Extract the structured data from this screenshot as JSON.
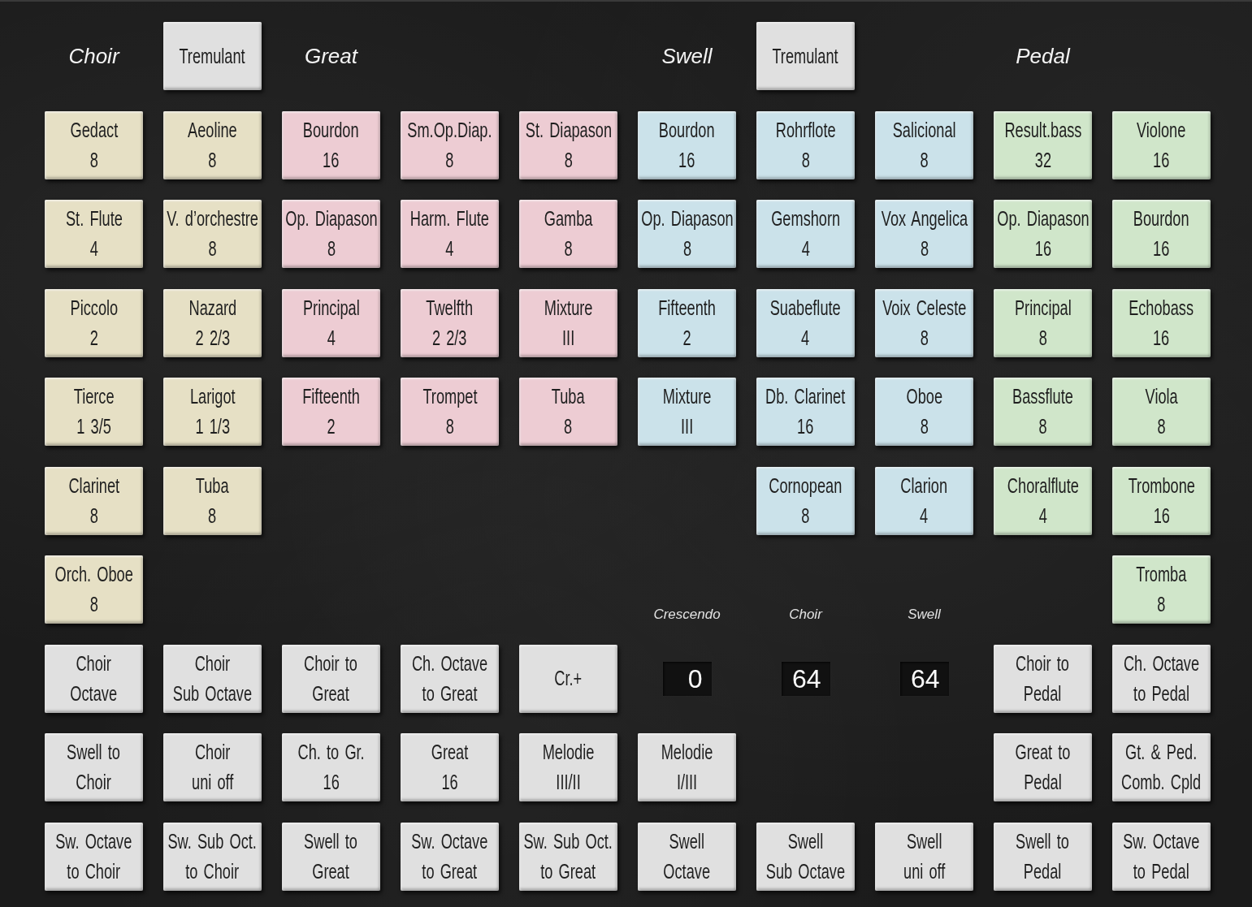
{
  "rows": [
    {
      "cells": [
        {
          "kind": "heading",
          "text": "Choir"
        },
        {
          "kind": "button",
          "lines": [
            "Tremulant"
          ],
          "color": "#e0e0e0"
        },
        {
          "kind": "heading",
          "text": "Great"
        },
        {
          "kind": "empty"
        },
        {
          "kind": "empty"
        },
        {
          "kind": "heading",
          "text": "Swell"
        },
        {
          "kind": "button",
          "lines": [
            "Tremulant"
          ],
          "color": "#e0e0e0"
        },
        {
          "kind": "empty"
        },
        {
          "kind": "heading",
          "text": "Pedal"
        },
        {
          "kind": "empty"
        }
      ]
    },
    {
      "cells": [
        {
          "kind": "button",
          "lines": [
            "Gedact",
            "8"
          ],
          "color": "#e6e0c5"
        },
        {
          "kind": "button",
          "lines": [
            "Aeoline",
            "8"
          ],
          "color": "#e6e0c5"
        },
        {
          "kind": "button",
          "lines": [
            "Bourdon",
            "16"
          ],
          "color": "#edccd3"
        },
        {
          "kind": "button",
          "lines": [
            "Sm.Op.Diap.",
            "8"
          ],
          "color": "#edccd3"
        },
        {
          "kind": "button",
          "lines": [
            "St. Diapason",
            "8"
          ],
          "color": "#edccd3"
        },
        {
          "kind": "button",
          "lines": [
            "Bourdon",
            "16"
          ],
          "color": "#cbe2ea"
        },
        {
          "kind": "button",
          "lines": [
            "Rohrflote",
            "8"
          ],
          "color": "#cbe2ea"
        },
        {
          "kind": "button",
          "lines": [
            "Salicional",
            "8"
          ],
          "color": "#cbe2ea"
        },
        {
          "kind": "button",
          "lines": [
            "Result.bass",
            "32"
          ],
          "color": "#d0e6ca"
        },
        {
          "kind": "button",
          "lines": [
            "Violone",
            "16"
          ],
          "color": "#d0e6ca"
        }
      ]
    },
    {
      "cells": [
        {
          "kind": "button",
          "lines": [
            "St. Flute",
            "4"
          ],
          "color": "#e6e0c5"
        },
        {
          "kind": "button",
          "lines": [
            "V. d’orchestre",
            "8"
          ],
          "color": "#e6e0c5"
        },
        {
          "kind": "button",
          "lines": [
            "Op. Diapason",
            "8"
          ],
          "color": "#edccd3"
        },
        {
          "kind": "button",
          "lines": [
            "Harm. Flute",
            "4"
          ],
          "color": "#edccd3"
        },
        {
          "kind": "button",
          "lines": [
            "Gamba",
            "8"
          ],
          "color": "#edccd3"
        },
        {
          "kind": "button",
          "lines": [
            "Op. Diapason",
            "8"
          ],
          "color": "#cbe2ea"
        },
        {
          "kind": "button",
          "lines": [
            "Gemshorn",
            "4"
          ],
          "color": "#cbe2ea"
        },
        {
          "kind": "button",
          "lines": [
            "Vox Angelica",
            "8"
          ],
          "color": "#cbe2ea"
        },
        {
          "kind": "button",
          "lines": [
            "Op. Diapason",
            "16"
          ],
          "color": "#d0e6ca"
        },
        {
          "kind": "button",
          "lines": [
            "Bourdon",
            "16"
          ],
          "color": "#d0e6ca"
        }
      ]
    },
    {
      "cells": [
        {
          "kind": "button",
          "lines": [
            "Piccolo",
            "2"
          ],
          "color": "#e6e0c5"
        },
        {
          "kind": "button",
          "lines": [
            "Nazard",
            "2 2/3"
          ],
          "color": "#e6e0c5"
        },
        {
          "kind": "button",
          "lines": [
            "Principal",
            "4"
          ],
          "color": "#edccd3"
        },
        {
          "kind": "button",
          "lines": [
            "Twelfth",
            "2 2/3"
          ],
          "color": "#edccd3"
        },
        {
          "kind": "button",
          "lines": [
            "Mixture",
            "III"
          ],
          "color": "#edccd3"
        },
        {
          "kind": "button",
          "lines": [
            "Fifteenth",
            "2"
          ],
          "color": "#cbe2ea"
        },
        {
          "kind": "button",
          "lines": [
            "Suabeflute",
            "4"
          ],
          "color": "#cbe2ea"
        },
        {
          "kind": "button",
          "lines": [
            "Voix Celeste",
            "8"
          ],
          "color": "#cbe2ea"
        },
        {
          "kind": "button",
          "lines": [
            "Principal",
            "8"
          ],
          "color": "#d0e6ca"
        },
        {
          "kind": "button",
          "lines": [
            "Echobass",
            "16"
          ],
          "color": "#d0e6ca"
        }
      ]
    },
    {
      "cells": [
        {
          "kind": "button",
          "lines": [
            "Tierce",
            "1 3/5"
          ],
          "color": "#e6e0c5"
        },
        {
          "kind": "button",
          "lines": [
            "Larigot",
            "1 1/3"
          ],
          "color": "#e6e0c5"
        },
        {
          "kind": "button",
          "lines": [
            "Fifteenth",
            "2"
          ],
          "color": "#edccd3"
        },
        {
          "kind": "button",
          "lines": [
            "Trompet",
            "8"
          ],
          "color": "#edccd3"
        },
        {
          "kind": "button",
          "lines": [
            "Tuba",
            "8"
          ],
          "color": "#edccd3"
        },
        {
          "kind": "button",
          "lines": [
            "Mixture",
            "III"
          ],
          "color": "#cbe2ea"
        },
        {
          "kind": "button",
          "lines": [
            "Db. Clarinet",
            "16"
          ],
          "color": "#cbe2ea"
        },
        {
          "kind": "button",
          "lines": [
            "Oboe",
            "8"
          ],
          "color": "#cbe2ea"
        },
        {
          "kind": "button",
          "lines": [
            "Bassflute",
            "8"
          ],
          "color": "#d0e6ca"
        },
        {
          "kind": "button",
          "lines": [
            "Viola",
            "8"
          ],
          "color": "#d0e6ca"
        }
      ]
    },
    {
      "cells": [
        {
          "kind": "button",
          "lines": [
            "Clarinet",
            "8"
          ],
          "color": "#e6e0c5"
        },
        {
          "kind": "button",
          "lines": [
            "Tuba",
            "8"
          ],
          "color": "#e6e0c5"
        },
        {
          "kind": "empty"
        },
        {
          "kind": "empty"
        },
        {
          "kind": "empty"
        },
        {
          "kind": "empty"
        },
        {
          "kind": "button",
          "lines": [
            "Cornopean",
            "8"
          ],
          "color": "#cbe2ea"
        },
        {
          "kind": "button",
          "lines": [
            "Clarion",
            "4"
          ],
          "color": "#cbe2ea"
        },
        {
          "kind": "button",
          "lines": [
            "Choralflute",
            "4"
          ],
          "color": "#d0e6ca"
        },
        {
          "kind": "button",
          "lines": [
            "Trombone",
            "16"
          ],
          "color": "#d0e6ca"
        }
      ]
    },
    {
      "cells": [
        {
          "kind": "button",
          "lines": [
            "Orch. Oboe",
            "8"
          ],
          "color": "#e6e0c5"
        },
        {
          "kind": "empty"
        },
        {
          "kind": "empty"
        },
        {
          "kind": "empty"
        },
        {
          "kind": "empty"
        },
        {
          "kind": "caption",
          "text": "Crescendo"
        },
        {
          "kind": "caption",
          "text": "Choir"
        },
        {
          "kind": "caption",
          "text": "Swell"
        },
        {
          "kind": "empty"
        },
        {
          "kind": "button",
          "lines": [
            "Tromba",
            "8"
          ],
          "color": "#d0e6ca"
        }
      ]
    },
    {
      "cells": [
        {
          "kind": "button",
          "lines": [
            "Choir",
            "Octave"
          ],
          "color": "#e0e0e0"
        },
        {
          "kind": "button",
          "lines": [
            "Choir",
            "Sub Octave"
          ],
          "color": "#e0e0e0"
        },
        {
          "kind": "button",
          "lines": [
            "Choir to",
            "Great"
          ],
          "color": "#e0e0e0"
        },
        {
          "kind": "button",
          "lines": [
            "Ch. Octave",
            "to Great"
          ],
          "color": "#e0e0e0"
        },
        {
          "kind": "button",
          "lines": [
            "Cr.+"
          ],
          "color": "#e0e0e0"
        },
        {
          "kind": "display",
          "value": "0"
        },
        {
          "kind": "display",
          "value": "64"
        },
        {
          "kind": "display",
          "value": "64"
        },
        {
          "kind": "button",
          "lines": [
            "Choir to",
            "Pedal"
          ],
          "color": "#e0e0e0"
        },
        {
          "kind": "button",
          "lines": [
            "Ch. Octave",
            "to Pedal"
          ],
          "color": "#e0e0e0"
        }
      ]
    },
    {
      "cells": [
        {
          "kind": "button",
          "lines": [
            "Swell to",
            "Choir"
          ],
          "color": "#e0e0e0"
        },
        {
          "kind": "button",
          "lines": [
            "Choir",
            "uni off"
          ],
          "color": "#e0e0e0"
        },
        {
          "kind": "button",
          "lines": [
            "Ch. to Gr.",
            "16"
          ],
          "color": "#e0e0e0"
        },
        {
          "kind": "button",
          "lines": [
            "Great",
            "16"
          ],
          "color": "#e0e0e0"
        },
        {
          "kind": "button",
          "lines": [
            "Melodie",
            "III/II"
          ],
          "color": "#e0e0e0"
        },
        {
          "kind": "button",
          "lines": [
            "Melodie",
            "I/III"
          ],
          "color": "#e0e0e0"
        },
        {
          "kind": "empty"
        },
        {
          "kind": "empty"
        },
        {
          "kind": "button",
          "lines": [
            "Great to",
            "Pedal"
          ],
          "color": "#e0e0e0"
        },
        {
          "kind": "button",
          "lines": [
            "Gt. & Ped.",
            "Comb. Cpld"
          ],
          "color": "#e0e0e0"
        }
      ]
    },
    {
      "cells": [
        {
          "kind": "button",
          "lines": [
            "Sw. Octave",
            "to Choir"
          ],
          "color": "#e0e0e0"
        },
        {
          "kind": "button",
          "lines": [
            "Sw. Sub Oct.",
            "to Choir"
          ],
          "color": "#e0e0e0"
        },
        {
          "kind": "button",
          "lines": [
            "Swell to",
            "Great"
          ],
          "color": "#e0e0e0"
        },
        {
          "kind": "button",
          "lines": [
            "Sw. Octave",
            "to Great"
          ],
          "color": "#e0e0e0"
        },
        {
          "kind": "button",
          "lines": [
            "Sw. Sub Oct.",
            "to Great"
          ],
          "color": "#e0e0e0"
        },
        {
          "kind": "button",
          "lines": [
            "Swell",
            "Octave"
          ],
          "color": "#e0e0e0"
        },
        {
          "kind": "button",
          "lines": [
            "Swell",
            "Sub Octave"
          ],
          "color": "#e0e0e0"
        },
        {
          "kind": "button",
          "lines": [
            "Swell",
            "uni off"
          ],
          "color": "#e0e0e0"
        },
        {
          "kind": "button",
          "lines": [
            "Swell to",
            "Pedal"
          ],
          "color": "#e0e0e0"
        },
        {
          "kind": "button",
          "lines": [
            "Sw. Octave",
            "to Pedal"
          ],
          "color": "#e0e0e0"
        }
      ]
    }
  ]
}
